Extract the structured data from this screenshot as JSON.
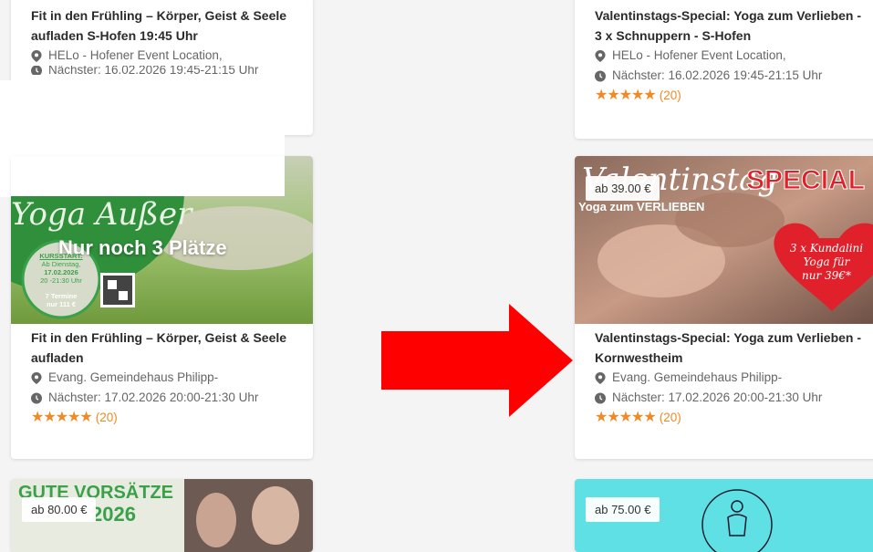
{
  "cards": {
    "top_left": {
      "title": "Fit in den Frühling – Körper, Geist & Seele aufladen S-Hofen 19:45 Uhr",
      "location": "HELo - Hofener Event Location,",
      "next": "Nächster: 16.02.2026 19:45-21:15 Uhr"
    },
    "top_right": {
      "title": "Valentinstags-Special: Yoga zum Verlieben - 3 x Schnuppern - S-Hofen",
      "location": "HELo - Hofener Event Location,",
      "next": "Nächster: 16.02.2026 19:45-21:15 Uhr",
      "rating_count": "(20)"
    },
    "mid_left": {
      "image_text": {
        "script": "Yoga Außer",
        "banner": "Nur noch 3 Plätze",
        "kursstart": "KURSSTART:",
        "weekday": "Ab Dienstag,",
        "date": "17.02.2026",
        "time": "20 -21:30 Uhr",
        "termine": "7 Termine",
        "price": "nur 111 €"
      },
      "title": "Fit in den Frühling – Körper, Geist & Seele aufladen",
      "location": "Evang. Gemeindehaus Philipp-",
      "next": "Nächster: 17.02.2026 20:00-21:30 Uhr",
      "rating_count": "(20)"
    },
    "mid_right": {
      "price": "ab 39.00 €",
      "image_text": {
        "script": "Valentinstag",
        "special": "SPECIAL",
        "sub": "Yoga zum VERLIEBEN",
        "heart1": "3 x Kundalini",
        "heart2": "Yoga für",
        "heart3": "nur 39€*"
      },
      "title": "Valentinstags-Special: Yoga zum Verlieben - Kornwestheim",
      "location": "Evang. Gemeindehaus Philipp-",
      "next": "Nächster: 17.02.2026 20:00-21:30 Uhr",
      "rating_count": "(20)"
    },
    "bottom_left": {
      "price": "ab 80.00 €",
      "image_text": {
        "line1": "GUTE VORSÄTZE",
        "line2": "2026"
      }
    },
    "bottom_right": {
      "price": "ab 75.00 €"
    }
  },
  "stars": "★★★★★",
  "colors": {
    "arrow": "#ff0000",
    "star": "#f08a24",
    "cyan": "#5ee0e4",
    "green": "#3aa14a"
  }
}
